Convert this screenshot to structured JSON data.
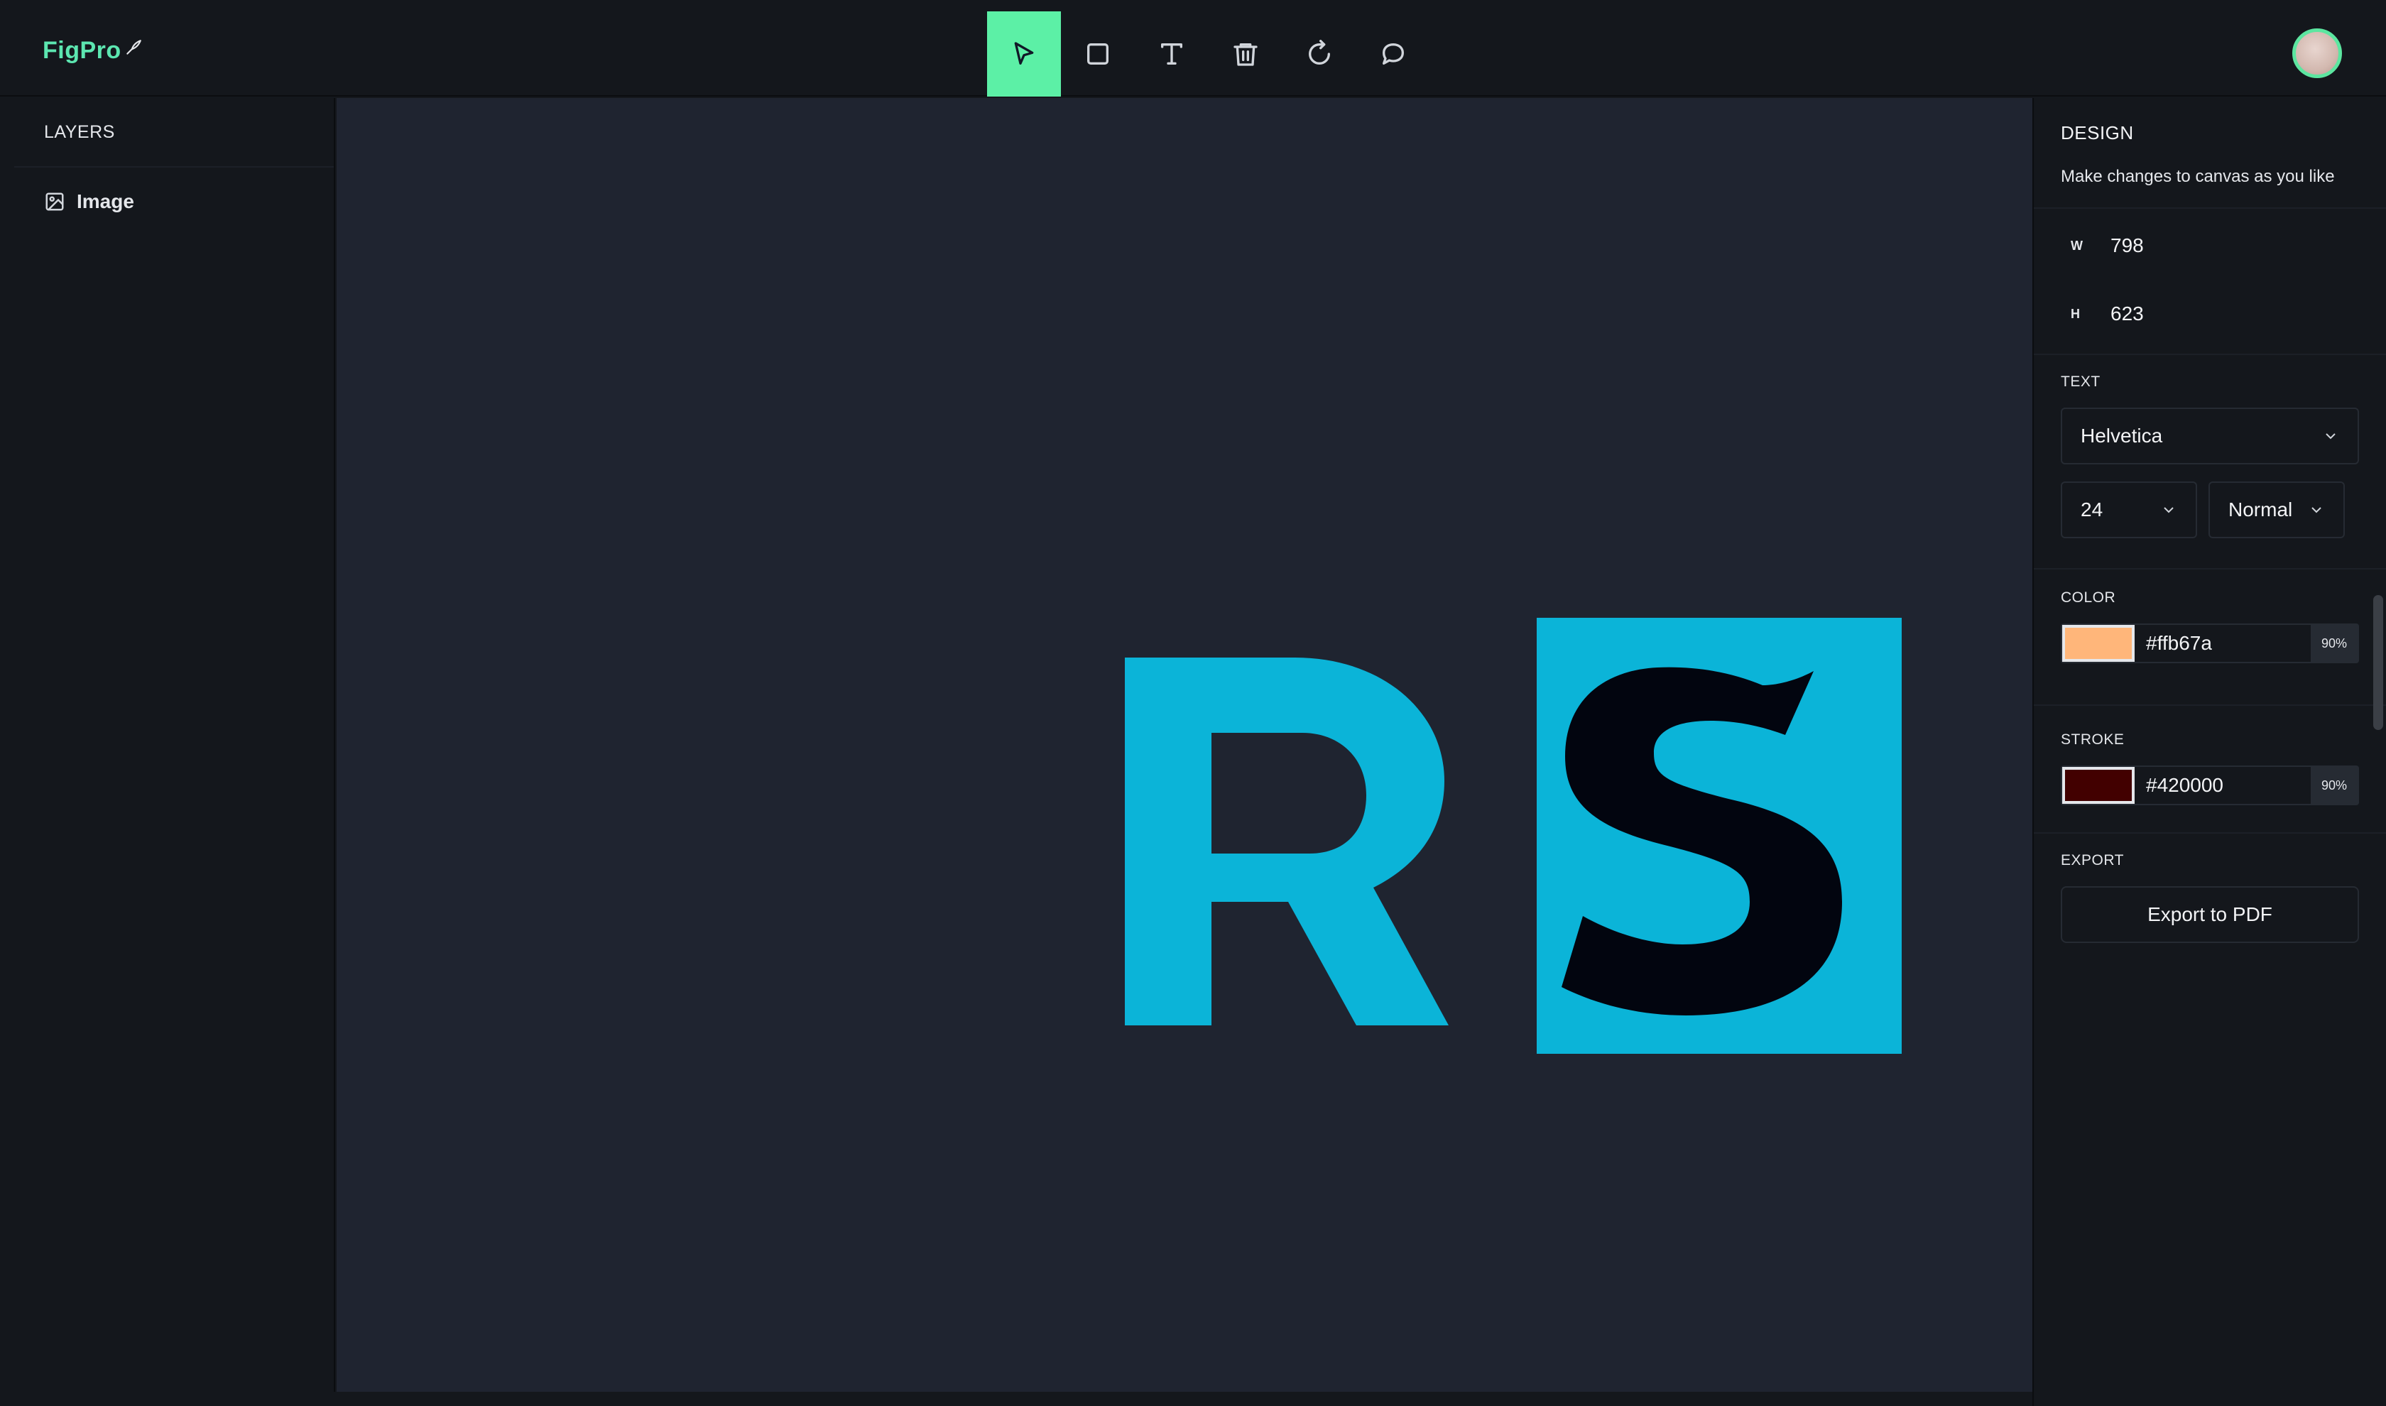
{
  "app": {
    "logo": "FigPro"
  },
  "toolbar": {
    "tools": [
      {
        "name": "select",
        "icon": "cursor-icon",
        "active": true
      },
      {
        "name": "rectangle",
        "icon": "square-icon"
      },
      {
        "name": "text",
        "icon": "text-icon"
      },
      {
        "name": "delete",
        "icon": "trash-icon"
      },
      {
        "name": "reset",
        "icon": "rotate-icon"
      },
      {
        "name": "comments",
        "icon": "comment-icon"
      }
    ],
    "accent": "#5cf0a6"
  },
  "layers": {
    "title": "LAYERS",
    "items": [
      {
        "label": "Image",
        "icon": "image-icon"
      }
    ]
  },
  "canvas": {
    "background": "#1f2430",
    "artwork": {
      "letter_left": "R",
      "letter_right": "S",
      "brand_color": "#0bb4d8",
      "dark_color": "#02050f"
    }
  },
  "design": {
    "title": "DESIGN",
    "subtitle": "Make changes to canvas as you like",
    "width_label": "W",
    "width_value": "798",
    "height_label": "H",
    "height_value": "623"
  },
  "text": {
    "title": "TEXT",
    "font_family": "Helvetica",
    "font_size": "24",
    "font_weight": "Normal"
  },
  "color": {
    "title": "COLOR",
    "hex": "#ffb67a",
    "opacity": "90%"
  },
  "stroke": {
    "title": "STROKE",
    "hex": "#420000",
    "opacity": "90%"
  },
  "export": {
    "title": "EXPORT",
    "button_label": "Export to PDF"
  }
}
